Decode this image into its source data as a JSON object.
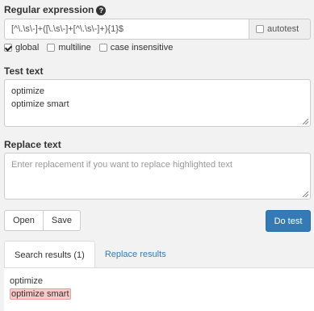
{
  "regex": {
    "label": "Regular expression",
    "help_icon": "?",
    "value": "[^\\.\\s\\-]+([\\.\\s\\-]+[^\\.\\s\\-]+){1}$",
    "autotest_label": "autotest",
    "autotest_checked": false
  },
  "flags": [
    {
      "label": "global",
      "checked": true
    },
    {
      "label": "multiline",
      "checked": false
    },
    {
      "label": "case insensitive",
      "checked": false
    }
  ],
  "test_text": {
    "label": "Test text",
    "lines": [
      "optimize",
      "optimize smart"
    ]
  },
  "replace_text": {
    "label": "Replace text",
    "placeholder": "Enter replacement if you want to replace highlighted text"
  },
  "buttons": {
    "open": "Open",
    "save": "Save",
    "do_test": "Do test"
  },
  "tabs": [
    {
      "label": "Search results (1)",
      "active": true
    },
    {
      "label": "Replace results",
      "active": false
    }
  ],
  "results": {
    "lines": [
      {
        "text": "optimize",
        "match": false
      },
      {
        "text": "optimize smart",
        "match": true
      }
    ]
  },
  "colors": {
    "primary": "#337ab7",
    "match_highlight": "#f9c9c9",
    "link": "#337ab7"
  }
}
